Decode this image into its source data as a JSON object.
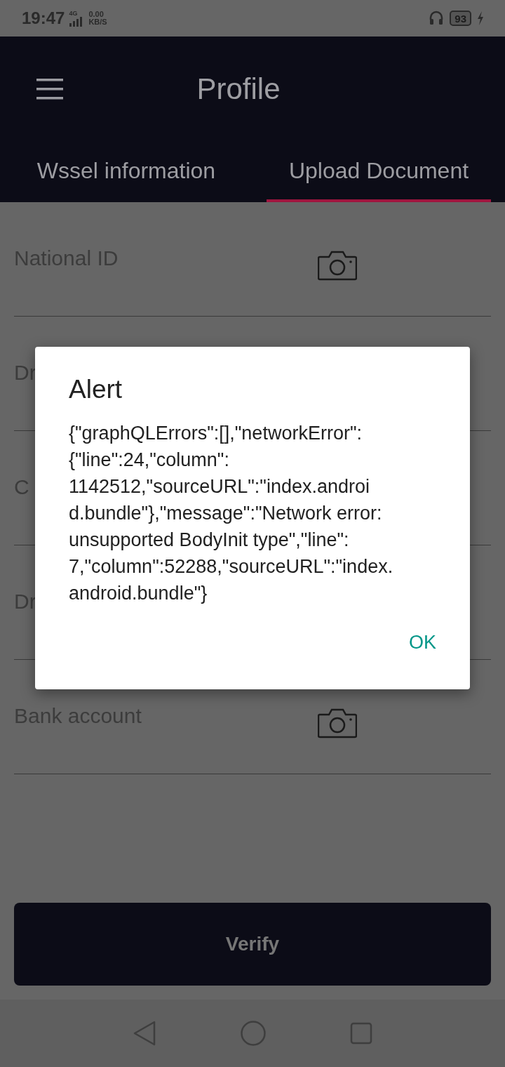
{
  "status_bar": {
    "time": "19:47",
    "network": "4G",
    "speed": "0.00",
    "speed_unit": "KB/S",
    "battery": "93"
  },
  "header": {
    "title": "Profile"
  },
  "tabs": [
    {
      "label": "Wssel information",
      "selected": false
    },
    {
      "label": "Upload Document",
      "selected": true
    }
  ],
  "documents": [
    {
      "label": "National ID",
      "camera": true
    },
    {
      "label": "Dr",
      "camera": false
    },
    {
      "label": "C",
      "camera": false
    },
    {
      "label": "Dr",
      "camera": false
    },
    {
      "label": "Bank account",
      "camera": true
    }
  ],
  "verify_button": "Verify",
  "dialog": {
    "title": "Alert",
    "message": "{\"graphQLErrors\":[],\"networkError\":\n{\"line\":24,\"column\":\n1142512,\"sourceURL\":\"index.androi\nd.bundle\"},\"message\":\"Network error:\nunsupported BodyInit type\",\"line\":\n7,\"column\":52288,\"sourceURL\":\"index.\nandroid.bundle\"}",
    "button": "OK"
  }
}
